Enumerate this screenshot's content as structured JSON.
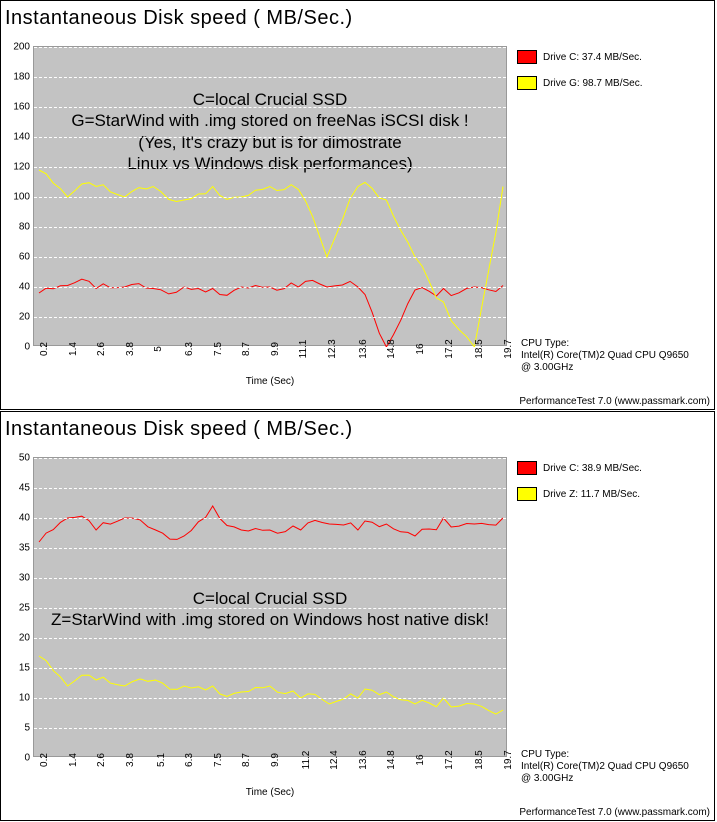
{
  "attribution": "PerformanceTest 7.0 (www.passmark.com)",
  "chart_data": [
    {
      "type": "line",
      "title": "Instantaneous Disk speed ( MB/Sec.)",
      "xlabel": "Time (Sec)",
      "ylabel": "",
      "ylim": [
        0,
        200
      ],
      "yticks": [
        0,
        20,
        40,
        60,
        80,
        100,
        120,
        140,
        160,
        180,
        200
      ],
      "x": [
        0.2,
        1.4,
        2.6,
        3.8,
        5.0,
        6.3,
        7.5,
        8.7,
        9.9,
        11.1,
        12.3,
        13.6,
        14.8,
        16.0,
        17.2,
        18.5,
        19.7
      ],
      "series": [
        {
          "name": "Drive C: 37.4 MB/Sec.",
          "color": "#ff0000",
          "values": [
            36,
            41,
            39,
            40,
            39,
            40,
            39,
            40,
            40,
            40,
            40,
            40,
            0,
            38,
            39,
            40,
            41
          ]
        },
        {
          "name": "Drive G: 98.7 MB/Sec.",
          "color": "#ffff00",
          "values": [
            118,
            100,
            107,
            100,
            107,
            98,
            107,
            100,
            107,
            105,
            60,
            107,
            98,
            60,
            30,
            0,
            107
          ]
        }
      ],
      "annotations": [
        "C=local Crucial SSD",
        "G=StarWind with .img stored on freeNas iSCSI disk !",
        "(Yes, It's crazy but is for dimostrate",
        "Linux vs Windows disk performances)"
      ],
      "cpu": {
        "label": "CPU Type:",
        "value": "Intel(R) Core(TM)2 Quad CPU Q9650 @ 3.00GHz"
      }
    },
    {
      "type": "line",
      "title": "Instantaneous Disk speed ( MB/Sec.)",
      "xlabel": "Time (Sec)",
      "ylabel": "",
      "ylim": [
        0,
        50
      ],
      "yticks": [
        0,
        5,
        10,
        15,
        20,
        25,
        30,
        35,
        40,
        45,
        50
      ],
      "x": [
        0.2,
        1.4,
        2.6,
        3.8,
        5.1,
        6.3,
        7.5,
        8.7,
        9.9,
        11.2,
        12.4,
        13.6,
        14.8,
        16.0,
        17.2,
        18.5,
        19.7
      ],
      "series": [
        {
          "name": "Drive C: 38.9 MB/Sec.",
          "color": "#ff0000",
          "values": [
            36,
            40,
            38,
            40,
            38,
            37,
            42,
            38,
            38,
            38,
            39,
            38,
            39,
            37,
            40,
            39,
            40
          ]
        },
        {
          "name": "Drive Z: 11.7 MB/Sec.",
          "color": "#ffff00",
          "values": [
            17,
            12,
            13,
            12,
            13,
            12,
            12,
            11,
            12,
            10,
            9,
            10,
            11,
            9,
            10,
            9,
            8
          ]
        }
      ],
      "annotations": [
        "C=local Crucial SSD",
        "Z=StarWind with .img stored on Windows host native disk!"
      ],
      "cpu": {
        "label": "CPU Type:",
        "value": "Intel(R) Core(TM)2 Quad CPU Q9650 @ 3.00GHz"
      }
    }
  ]
}
